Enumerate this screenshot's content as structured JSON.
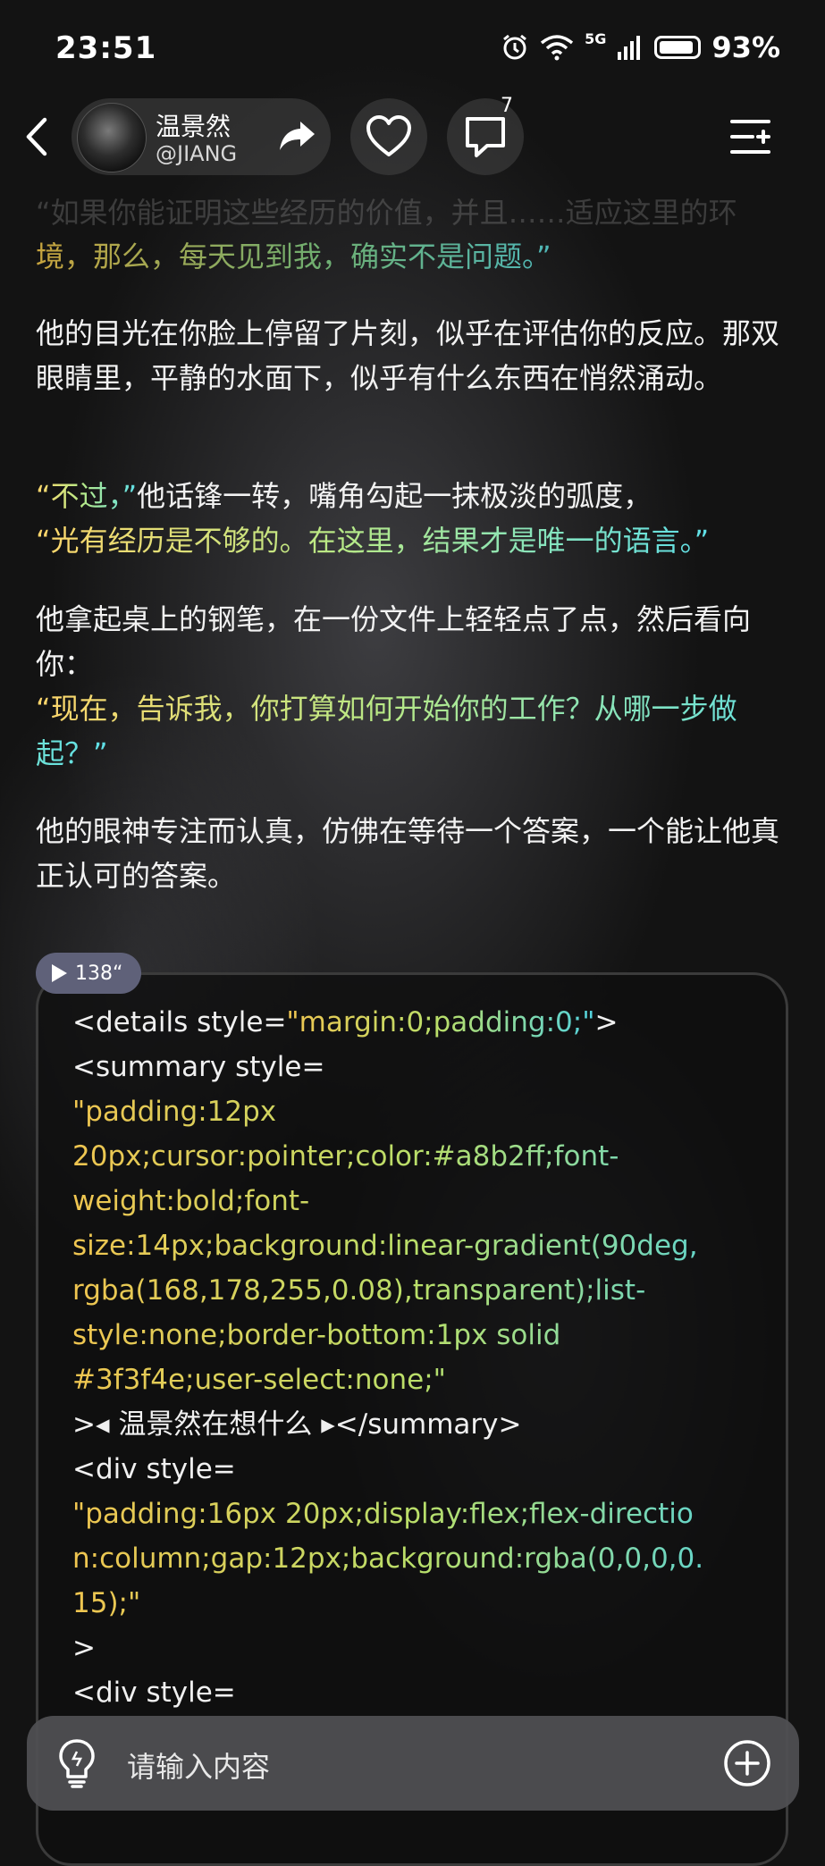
{
  "status_bar": {
    "time": "23:51",
    "network": "5G",
    "battery": "93%"
  },
  "header": {
    "character_name": "温景然",
    "handle": "@JIANG",
    "comment_count": "7"
  },
  "story": {
    "faded_top": "“如果你能证明这些经历的价值，并且……适应这里的环",
    "quote_1": "境，那么，每天见到我，确实不是问题。”",
    "para_1": "他的目光在你脸上停留了片刻，似乎在评估你的反应。那双眼睛里，平静的水面下，似乎有什么东西在悄然涌动。",
    "quote_2a": "“不过，”",
    "para_2": "他话锋一转，嘴角勾起一抹极淡的弧度，",
    "quote_2b": "“光有经历是不够的。在这里，结果才是唯一的语言。”",
    "para_3": "他拿起桌上的钢笔，在一份文件上轻轻点了点，然后看向你：",
    "quote_3": "“现在，告诉我，你打算如何开始你的工作？从哪一步做起？”",
    "para_4": "他的眼神专注而认真，仿佛在等待一个答案，一个能让他真正认可的答案。"
  },
  "audio": {
    "duration": "138“"
  },
  "code": {
    "l1a": "<details style=",
    "l1b": "\"margin:0;padding:0;\"",
    "l1c": ">",
    "l2": "<summary style=",
    "l3": "\"padding:12px",
    "l4": "20px;cursor:pointer;color:#a8b2ff;font-",
    "l5": "weight:bold;font-",
    "l6": "size:14px;background:linear-gradient(90deg,",
    "l7": "rgba(168,178,255,0.08),transparent);list-",
    "l8": "style:none;border-bottom:1px solid",
    "l9": "#3f3f4e;user-select:none;\"",
    "l10": ">◂ 温景然在想什么 ▸</summary>",
    "l11": "<div style=",
    "l12": "\"padding:16px 20px;display:flex;flex-directio",
    "l13": "n:column;gap:12px;background:rgba(0,0,0,0.",
    "l14": "15);\"",
    "l15": ">",
    "l16": "<div style="
  },
  "input": {
    "placeholder": "请输入内容"
  }
}
